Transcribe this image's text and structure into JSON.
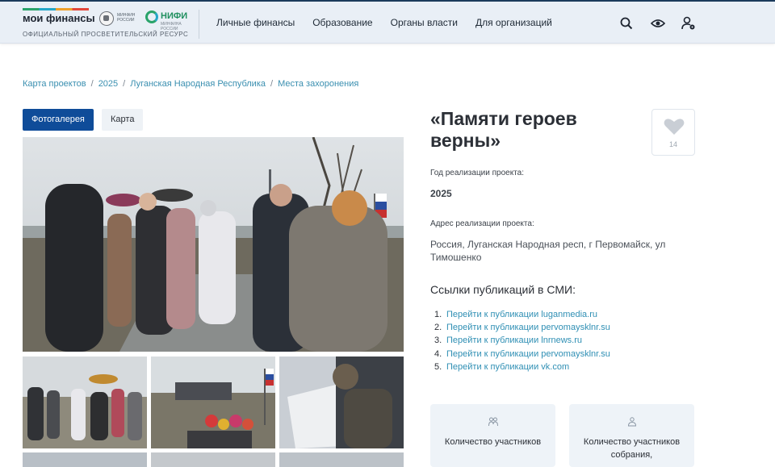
{
  "header": {
    "logo_name": "мои финансы",
    "logo_tagline": "ОФИЦИАЛЬНЫЙ ПРОСВЕТИТЕЛЬСКИЙ РЕСУРС",
    "partner_minfin": "МИНФИН РОССИИ",
    "partner_nifi": "НИФИ",
    "partner_nifi_sub": "МИНФИНА РОССИИ",
    "nav": [
      "Личные финансы",
      "Образование",
      "Органы власти",
      "Для организаций"
    ],
    "icons": [
      "search-icon",
      "eye-icon",
      "user-settings-icon"
    ]
  },
  "breadcrumb": [
    "Карта проектов",
    "2025",
    "Луганская Народная Республика",
    "Места захоронения"
  ],
  "tabs": {
    "gallery": "Фотогалерея",
    "map": "Карта"
  },
  "project": {
    "title": "«Памяти героев верны»",
    "likes": "14",
    "year_label": "Год реализации проекта:",
    "year_value": "2025",
    "address_label": "Адрес реализации проекта:",
    "address_value": "Россия, Луганская Народная респ, г Первомайск, ул Тимошенко",
    "smi_title": "Ссылки публикаций в СМИ:",
    "links": [
      {
        "num": "1.",
        "text": "Перейти к публикации luganmedia.ru"
      },
      {
        "num": "2.",
        "text": "Перейти к публикации pervomaysklnr.su"
      },
      {
        "num": "3.",
        "text": "Перейти к публикации lnrnews.ru"
      },
      {
        "num": "4.",
        "text": "Перейти к публикации pervomaysklnr.su"
      },
      {
        "num": "5.",
        "text": "Перейти к публикации vk.com"
      }
    ]
  },
  "stats": [
    {
      "label": "Количество участников"
    },
    {
      "label": "Количество участников собрания,"
    }
  ],
  "colors": {
    "accent": "#0f4c99",
    "link": "#2f8fb4",
    "header_bg": "#e9eff6",
    "card_bg": "#eef3f8"
  }
}
